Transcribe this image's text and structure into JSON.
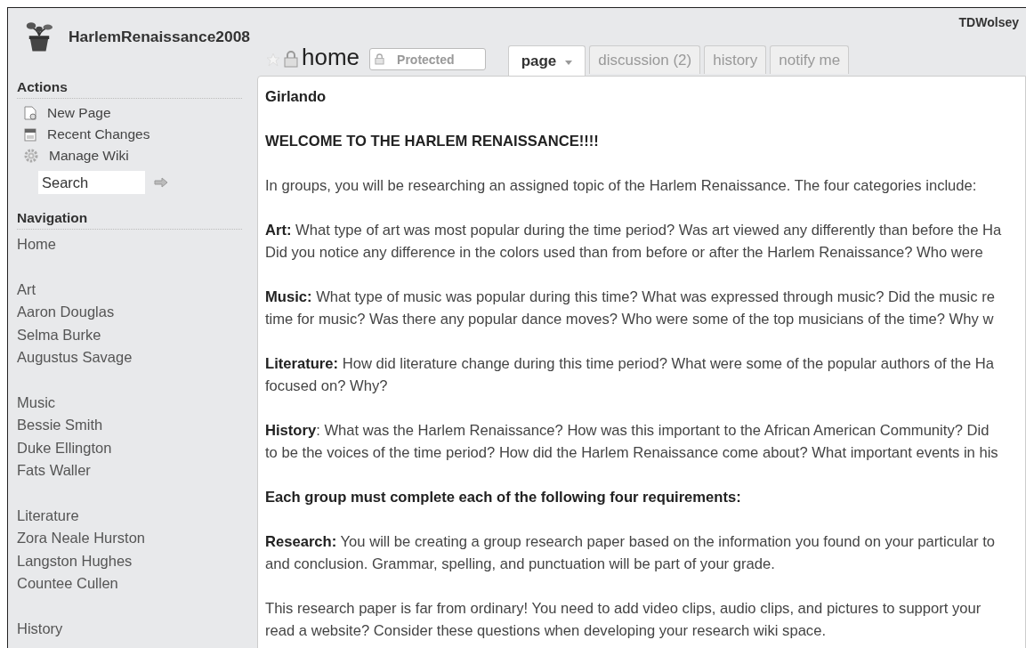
{
  "site": {
    "name": "HarlemRenaissance2008"
  },
  "user": {
    "name": "TDWolsey"
  },
  "sidebar": {
    "actions": {
      "heading": "Actions",
      "items": [
        {
          "label": "New Page",
          "kind": "page"
        },
        {
          "label": "Recent Changes",
          "kind": "calendar"
        },
        {
          "label": "Manage Wiki",
          "kind": "gear"
        }
      ]
    },
    "search": {
      "value": "Search"
    },
    "navigation": {
      "heading": "Navigation",
      "groups": [
        {
          "items": [
            "Home"
          ]
        },
        {
          "items": [
            "Art",
            "Aaron Douglas",
            "Selma Burke",
            "Augustus Savage"
          ]
        },
        {
          "items": [
            "Music",
            "Bessie Smith",
            "Duke Ellington",
            "Fats Waller"
          ]
        },
        {
          "items": [
            "Literature",
            "Zora Neale Hurston",
            "Langston Hughes",
            "Countee Cullen"
          ]
        },
        {
          "items": [
            "History"
          ]
        }
      ]
    }
  },
  "page": {
    "title": "home",
    "status": "Protected",
    "tabs": [
      {
        "label": "page",
        "selected": true,
        "has_menu": true
      },
      {
        "label": "discussion (2)",
        "selected": false,
        "has_menu": false
      },
      {
        "label": "history",
        "selected": false,
        "has_menu": false
      },
      {
        "label": "notify me",
        "selected": false,
        "has_menu": false
      }
    ]
  },
  "content": {
    "blocks": [
      {
        "kind": "heading",
        "lines": [
          "Girlando"
        ]
      },
      {
        "kind": "heading",
        "lines": [
          "WELCOME TO THE HARLEM RENAISSANCE!!!!"
        ]
      },
      {
        "kind": "paragraph",
        "lines": [
          "In groups, you will be researching an assigned topic of the Harlem Renaissance. The four categories include:"
        ]
      },
      {
        "kind": "paragraph",
        "lines": [
          "**Art:** What type of art was most popular during the time period? Was art viewed any differently than before the Ha",
          "Did you notice any difference in the colors used than from before or after the Harlem Renaissance? Who were"
        ]
      },
      {
        "kind": "paragraph",
        "lines": [
          "**Music:** What type of music was popular during this time? What was expressed through music? Did the music re",
          "time for music? Was there any popular dance moves? Who were some of the top musicians of the time? Why w"
        ]
      },
      {
        "kind": "paragraph",
        "lines": [
          "**Literature:** How did literature change during this time period? What were some of the popular authors of the Ha",
          "focused on? Why?"
        ]
      },
      {
        "kind": "paragraph",
        "lines": [
          "**History**: What was the Harlem Renaissance? How was this important to the African American Community? Did",
          "to be the voices of the time period? How did the Harlem Renaissance come about? What important events in his"
        ]
      },
      {
        "kind": "heading",
        "lines": [
          "Each group must complete each of the following four requirements:"
        ]
      },
      {
        "kind": "paragraph",
        "lines": [
          "**Research:** You will be creating a group research paper based on the information you found on your particular to",
          "and conclusion. Grammar, spelling, and punctuation will be part of your grade."
        ]
      },
      {
        "kind": "paragraph",
        "lines": [
          "This research paper is far from ordinary! You need to add video clips, audio clips, and pictures to support your",
          "read a website? Consider these questions when developing your research wiki space."
        ]
      }
    ]
  }
}
